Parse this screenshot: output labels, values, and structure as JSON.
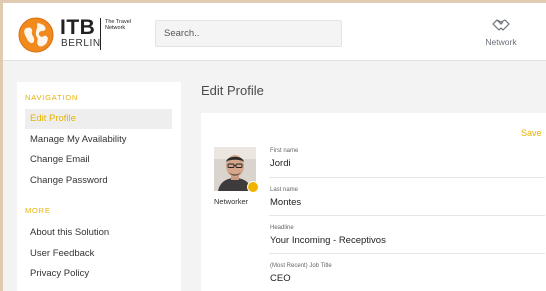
{
  "header": {
    "logo": {
      "brand": "ITB",
      "city": "BERLIN",
      "tagline": "The Travel Network"
    },
    "search": {
      "placeholder": "Search..",
      "value": ""
    },
    "nav": {
      "network_label": "Network"
    }
  },
  "sidebar": {
    "sections": [
      {
        "heading": "NAVIGATION",
        "items": [
          {
            "label": "Edit Profile",
            "active": true
          },
          {
            "label": "Manage My Availability",
            "active": false
          },
          {
            "label": "Change Email",
            "active": false
          },
          {
            "label": "Change Password",
            "active": false
          }
        ]
      },
      {
        "heading": "MORE",
        "items": [
          {
            "label": "About this Solution",
            "active": false
          },
          {
            "label": "User Feedback",
            "active": false
          },
          {
            "label": "Privacy Policy",
            "active": false
          }
        ]
      }
    ]
  },
  "main": {
    "title": "Edit Profile",
    "save_label": "Save",
    "avatar_role": "Networker",
    "fields": [
      {
        "label": "First name",
        "value": "Jordi"
      },
      {
        "label": "Last name",
        "value": "Montes"
      },
      {
        "label": "Headline",
        "value": "Your Incoming - Receptivos"
      },
      {
        "label": "(Most Recent) Job Title",
        "value": "CEO"
      }
    ]
  },
  "colors": {
    "accent": "#e7b300",
    "logo_orange": "#f08a1c",
    "frame": "#e0cbb2"
  }
}
